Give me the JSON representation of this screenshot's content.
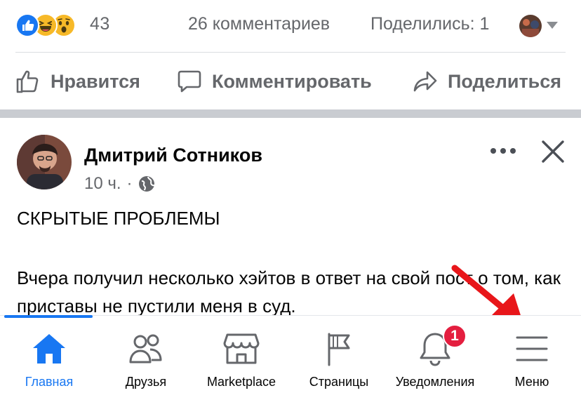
{
  "reactions": {
    "icons": [
      "like-icon",
      "haha-icon",
      "wow-icon"
    ],
    "count": "43",
    "comments": "26 комментариев",
    "shares": "Поделились: 1"
  },
  "actions": {
    "like": "Нравится",
    "comment": "Комментировать",
    "share": "Поделиться"
  },
  "post": {
    "author": "Дмитрий Сотников",
    "time": "10 ч.",
    "separator": "·",
    "title": "СКРЫТЫЕ ПРОБЛЕМЫ",
    "body": "Вчера получил несколько хэйтов в ответ на свой пост о том, как приставы не пустили меня в суд."
  },
  "nav": {
    "items": [
      {
        "label": "Главная",
        "icon": "home-icon",
        "active": true
      },
      {
        "label": "Друзья",
        "icon": "friends-icon"
      },
      {
        "label": "Marketplace",
        "icon": "marketplace-icon"
      },
      {
        "label": "Страницы",
        "icon": "flag-icon"
      },
      {
        "label": "Уведомления",
        "icon": "bell-icon",
        "badge": "1"
      },
      {
        "label": "Меню",
        "icon": "hamburger-menu-icon"
      }
    ]
  },
  "colors": {
    "accent": "#1877f2",
    "badge": "#e41e3f",
    "muted": "#65676b",
    "arrow": "#e8161a"
  }
}
